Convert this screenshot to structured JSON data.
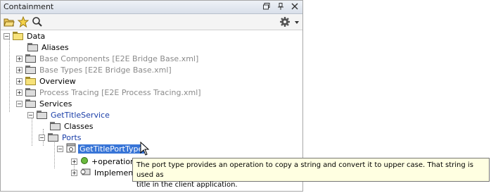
{
  "panel": {
    "title": "Containment"
  },
  "titlebar_icons": [
    "restore-icon",
    "pin-icon",
    "close-icon"
  ],
  "toolbar": {
    "tools": [
      "open-folder-icon",
      "favorite-star-icon",
      "search-icon"
    ],
    "settings": "gear-icon"
  },
  "tree": {
    "root": "Data",
    "aliases": "Aliases",
    "base_components": "Base Components [E2E Bridge Base.xml]",
    "base_types": "Base Types [E2E Bridge Base.xml]",
    "overview": "Overview",
    "process_tracing": "Process Tracing [E2E Process Tracing.xml]",
    "services": "Services",
    "get_title_service": "GetTitleService",
    "classes": "Classes",
    "ports": "Ports",
    "get_title_port_type": "GetTitlePortType",
    "operation": "+operation",
    "implementation": "Implementa"
  },
  "tooltip": {
    "line1": "The port type provides an operation to copy a string and convert it to upper case. That string is used as",
    "line2": "title in the client application."
  },
  "colors": {
    "selection": "#3875d7",
    "link": "#1a3ea8",
    "muted": "#8a8a8a",
    "tooltip_bg": "#ffffe1"
  }
}
